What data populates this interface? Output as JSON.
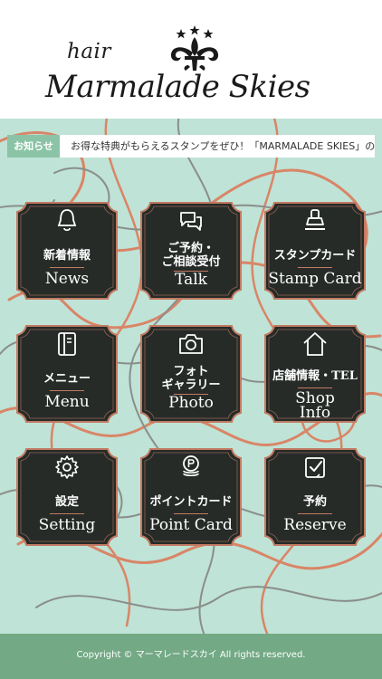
{
  "header": {
    "logo_hair": "hair",
    "logo_name": "Marmalade Skies"
  },
  "notice": {
    "badge": "お知らせ",
    "text": "お得な特典がもらえるスタンプをぜひ！「MARMALADE SKIES」の最新情"
  },
  "menu": {
    "news": {
      "jp": "新着情報",
      "en": "News",
      "icon": "bell-icon"
    },
    "talk": {
      "jp1": "ご予約・",
      "jp2": "ご相談受付",
      "en": "Talk",
      "icon": "chat-bubbles-icon"
    },
    "stamp": {
      "jp": "スタンプカード",
      "en": "Stamp Card",
      "icon": "stamp-icon"
    },
    "menu": {
      "jp": "メニュー",
      "en": "Menu",
      "icon": "book-icon"
    },
    "photo": {
      "jp1": "フォト",
      "jp2": "ギャラリー",
      "en": "Photo",
      "icon": "camera-icon"
    },
    "shop": {
      "jp": "店舗情報・TEL",
      "en1": "Shop",
      "en2": "Info",
      "icon": "home-icon"
    },
    "settings": {
      "jp": "設定",
      "en": "Setting",
      "icon": "gear-icon"
    },
    "points": {
      "jp": "ポイントカード",
      "en": "Point Card",
      "icon": "coins-icon"
    },
    "reserve": {
      "jp": "予約",
      "en": "Reserve",
      "icon": "calendar-check-icon"
    }
  },
  "footer": {
    "copyright": "Copyright © マーマレードスカイ All rights reserved."
  },
  "colors": {
    "tile_fill": "#262b28",
    "tile_border": "#c27a62",
    "background": "#bfe3d6",
    "accent_green": "#8bc3a6",
    "footer_green": "#73a985"
  }
}
